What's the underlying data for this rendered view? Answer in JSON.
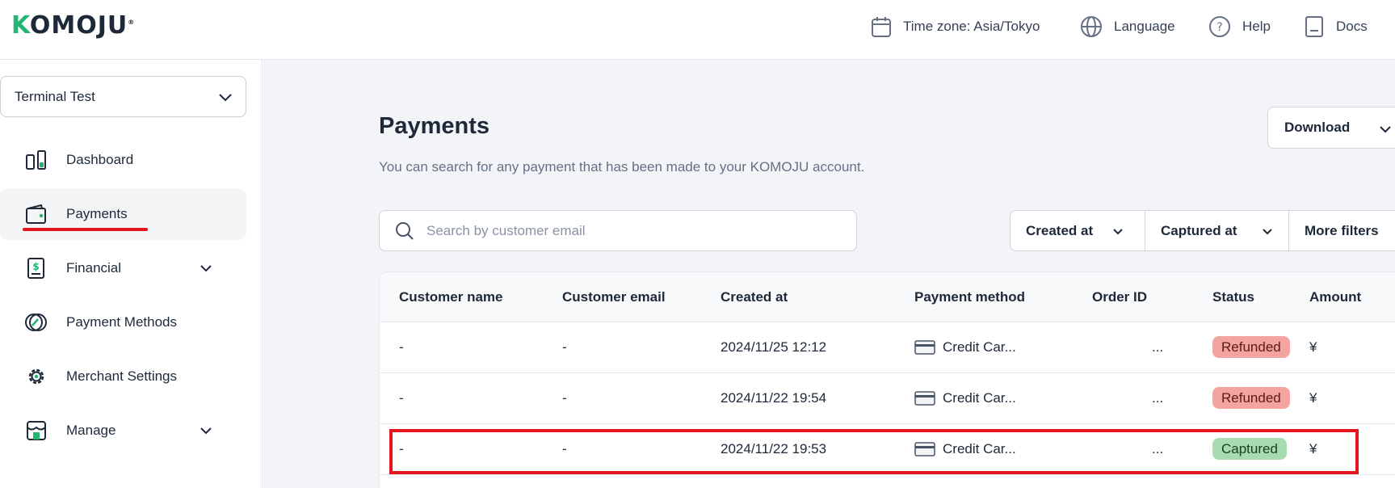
{
  "header": {
    "logo_text": "OMOJU",
    "logo_initial": "K",
    "logo_mark": "®",
    "timezone": "Time zone: Asia/Tokyo",
    "language": "Language",
    "help": "Help",
    "docs": "Docs"
  },
  "sidebar": {
    "merchant_select": "Terminal Test",
    "items": [
      {
        "label": "Dashboard",
        "icon": "dashboard-icon"
      },
      {
        "label": "Payments",
        "icon": "wallet-icon",
        "active": true
      },
      {
        "label": "Financial",
        "icon": "ledger-icon",
        "expandable": true
      },
      {
        "label": "Payment Methods",
        "icon": "payment-methods-icon"
      },
      {
        "label": "Merchant Settings",
        "icon": "gear-icon"
      },
      {
        "label": "Manage",
        "icon": "store-icon",
        "expandable": true
      }
    ]
  },
  "main": {
    "title": "Payments",
    "subtitle": "You can search for any payment that has been made to your KOMOJU account.",
    "download_label": "Download",
    "search_placeholder": "Search by customer email",
    "filters": [
      "Created at",
      "Captured at",
      "More filters"
    ],
    "columns": [
      "Customer name",
      "Customer email",
      "Created at",
      "Payment method",
      "Order ID",
      "Status",
      "Amount"
    ],
    "rows": [
      {
        "customer_name": "-",
        "customer_email": "-",
        "created_at": "2024/11/25 12:12",
        "payment_method": "Credit Car...",
        "order_id": "...",
        "status": "Refunded",
        "amount": "¥"
      },
      {
        "customer_name": "-",
        "customer_email": "-",
        "created_at": "2024/11/22 19:54",
        "payment_method": "Credit Car...",
        "order_id": "...",
        "status": "Refunded",
        "amount": "¥"
      },
      {
        "customer_name": "-",
        "customer_email": "-",
        "created_at": "2024/11/22 19:53",
        "payment_method": "Credit Car...",
        "order_id": "...",
        "status": "Captured",
        "amount": "¥"
      }
    ]
  },
  "colors": {
    "brand_green": "#22b573",
    "annotation_red": "#e4151f",
    "refunded_badge": "#f4a4a0",
    "captured_badge": "#a8dcb0"
  }
}
